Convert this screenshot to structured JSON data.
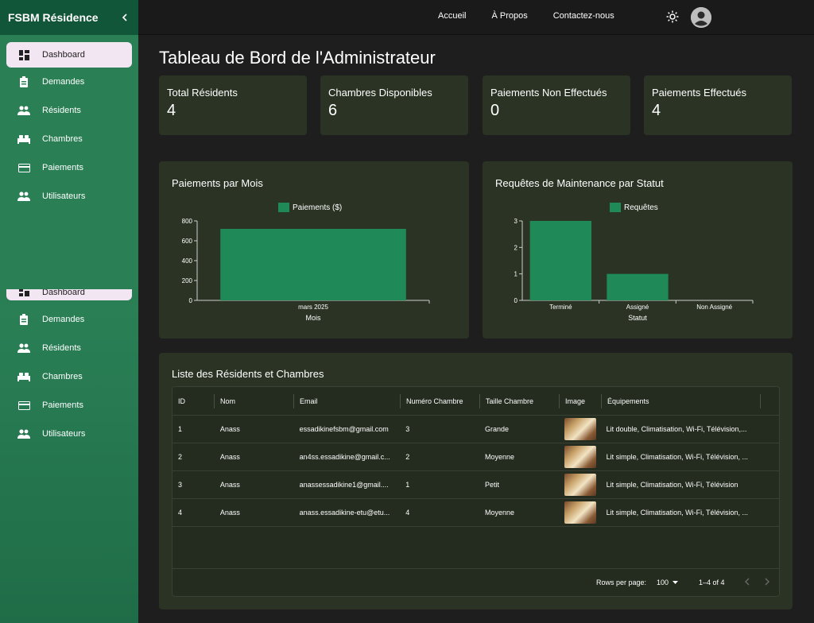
{
  "sidebar": {
    "brand": "FSBM Résidence",
    "collapse_icon": "chevron-left-icon",
    "items": [
      {
        "label": "Dashboard",
        "icon": "dashboard-icon"
      },
      {
        "label": "Demandes",
        "icon": "clipboard-icon"
      },
      {
        "label": "Résidents",
        "icon": "people-icon"
      },
      {
        "label": "Chambres",
        "icon": "bed-icon"
      },
      {
        "label": "Paiements",
        "icon": "credit-card-icon"
      },
      {
        "label": "Utilisateurs",
        "icon": "people-icon"
      }
    ]
  },
  "topbar": {
    "links": [
      "Accueil",
      "À Propos",
      "Contactez-nous"
    ],
    "theme_icon": "sun-icon",
    "avatar_icon": "user-avatar-icon"
  },
  "page": {
    "title": "Tableau de Bord de l'Administrateur"
  },
  "stats": [
    {
      "label": "Total Résidents",
      "value": "4"
    },
    {
      "label": "Chambres Disponibles",
      "value": "6"
    },
    {
      "label": "Paiements Non Effectués",
      "value": "0"
    },
    {
      "label": "Paiements Effectués",
      "value": "4"
    }
  ],
  "chart_data": [
    {
      "type": "bar",
      "title": "Paiements par Mois",
      "categories": [
        "mars 2025"
      ],
      "series": [
        {
          "name": "Paiements ($)",
          "values": [
            720
          ]
        }
      ],
      "xlabel": "Mois",
      "ylabel": "",
      "ylim": [
        0,
        800
      ],
      "yticks": [
        "0",
        "200",
        "400",
        "600",
        "800"
      ],
      "legend": "top",
      "color": "#1f8a57"
    },
    {
      "type": "bar",
      "title": "Requêtes de Maintenance par Statut",
      "categories": [
        "Terminé",
        "Assigné",
        "Non Assigné"
      ],
      "series": [
        {
          "name": "Requêtes",
          "values": [
            3,
            1,
            0
          ]
        }
      ],
      "xlabel": "Statut",
      "ylabel": "",
      "ylim": [
        0,
        3
      ],
      "yticks": [
        "0",
        "1",
        "2",
        "3"
      ],
      "legend": "top",
      "color": "#1f8a57"
    }
  ],
  "residents": {
    "title": "Liste des Résidents et Chambres",
    "columns": [
      "ID",
      "Nom",
      "Email",
      "Numéro Chambre",
      "Taille Chambre",
      "Image",
      "Équipements"
    ],
    "rows": [
      {
        "id": "1",
        "nom": "Anass",
        "email": "essadikinefsbm@gmail.com",
        "num": "3",
        "taille": "Grande",
        "equip": "Lit double, Climatisation, Wi-Fi, Télévision,..."
      },
      {
        "id": "2",
        "nom": "Anass",
        "email": "an4ss.essadikine@gmail.c...",
        "num": "2",
        "taille": "Moyenne",
        "equip": "Lit simple, Climatisation, Wi-Fi, Télévision, ..."
      },
      {
        "id": "3",
        "nom": "Anass",
        "email": "anassessadikine1@gmail....",
        "num": "1",
        "taille": "Petit",
        "equip": "Lit simple, Climatisation, Wi-Fi, Télévision"
      },
      {
        "id": "4",
        "nom": "Anass",
        "email": "anass.essadikine-etu@etu...",
        "num": "4",
        "taille": "Moyenne",
        "equip": "Lit simple, Climatisation, Wi-Fi, Télévision, ..."
      }
    ],
    "footer": {
      "rows_label": "Rows per page:",
      "rows_value": "100",
      "range": "1–4 of 4"
    }
  }
}
